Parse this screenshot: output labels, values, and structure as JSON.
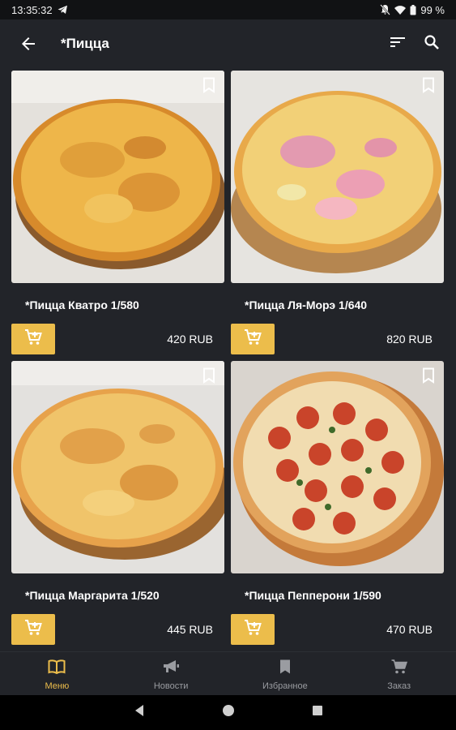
{
  "status_bar": {
    "time": "13:35:32",
    "battery": "99 %"
  },
  "app_bar": {
    "title": "*Пицца"
  },
  "products": [
    {
      "name": "*Пицца Кватро 1/580",
      "price": "420 RUB"
    },
    {
      "name": "*Пицца Ля-Морэ 1/640",
      "price": "820 RUB"
    },
    {
      "name": "*Пицца Маргарита 1/520",
      "price": "445 RUB"
    },
    {
      "name": "*Пицца Пепперони 1/590",
      "price": "470 RUB"
    }
  ],
  "bottom_nav": {
    "items": [
      {
        "label": "Меню",
        "icon": "book-icon",
        "active": true
      },
      {
        "label": "Новости",
        "icon": "megaphone-icon",
        "active": false
      },
      {
        "label": "Избранное",
        "icon": "bookmark-icon",
        "active": false
      },
      {
        "label": "Заказ",
        "icon": "cart-icon",
        "active": false
      }
    ]
  },
  "colors": {
    "accent": "#ecbd4b",
    "background": "#222429",
    "status_bar": "#111214"
  }
}
